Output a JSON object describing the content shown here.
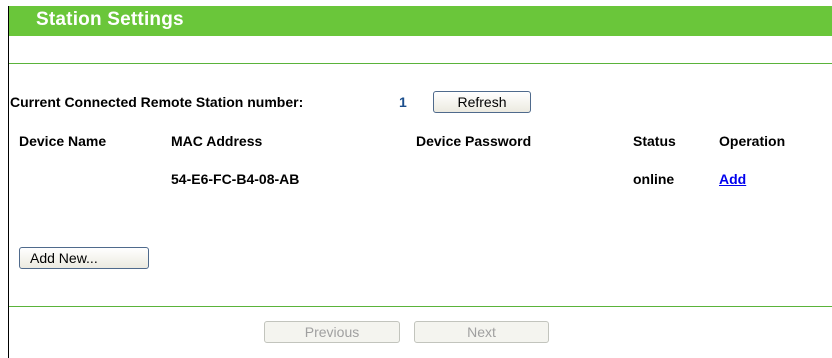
{
  "header": {
    "title": "Station Settings"
  },
  "summary": {
    "label": "Current Connected Remote Station number:",
    "count": "1",
    "refresh_label": "Refresh"
  },
  "table": {
    "columns": [
      "Device Name",
      "MAC Address",
      "Device Password",
      "Status",
      "Operation"
    ],
    "rows": [
      {
        "device_name": "",
        "mac": "54-E6-FC-B4-08-AB",
        "password": "",
        "status": "online",
        "operation": "Add"
      }
    ]
  },
  "actions": {
    "add_new_label": "Add New...",
    "previous_label": "Previous",
    "next_label": "Next"
  },
  "colors": {
    "header_green": "#6ac63a",
    "divider_green": "#5ab33a",
    "count_blue": "#1b4e8c",
    "link_blue": "#0000ee"
  }
}
